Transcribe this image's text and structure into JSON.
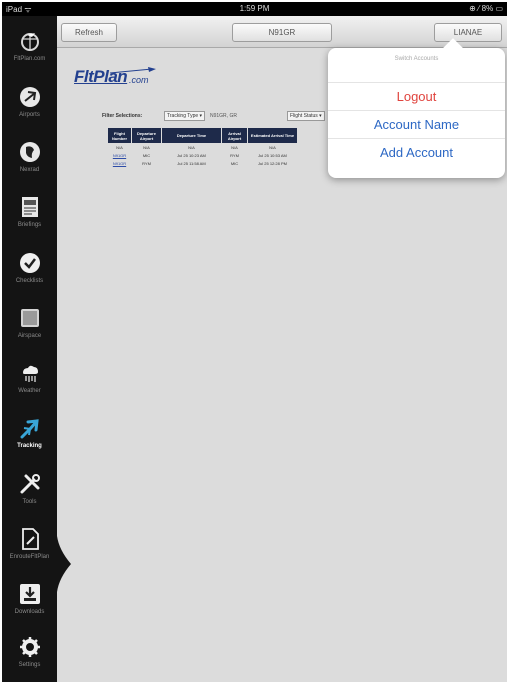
{
  "status_bar": {
    "carrier": "iPad ᯤ",
    "time": "1:59 PM",
    "battery": "⊕ ⁄ 8% ▭"
  },
  "sidebar": {
    "items": [
      {
        "label": "FltPlan.com",
        "icon": "globe-plane-icon"
      },
      {
        "label": "Airports",
        "icon": "airport-icon"
      },
      {
        "label": "Nexrad",
        "icon": "radar-icon"
      },
      {
        "label": "Briefings",
        "icon": "document-icon"
      },
      {
        "label": "Checklists",
        "icon": "checkmark-icon"
      },
      {
        "label": "Airspace",
        "icon": "airspace-icon"
      },
      {
        "label": "Weather",
        "icon": "cloud-rain-icon"
      },
      {
        "label": "Tracking",
        "icon": "plane-icon"
      },
      {
        "label": "Tools",
        "icon": "tools-icon"
      },
      {
        "label": "EnrouteFltPlan",
        "icon": "edit-document-icon"
      },
      {
        "label": "Downloads",
        "icon": "download-icon"
      },
      {
        "label": "Settings",
        "icon": "gear-icon"
      }
    ],
    "active_index": 7
  },
  "toolbar": {
    "refresh_label": "Refresh",
    "center_label": "N91GR",
    "account_label": "LIANAE"
  },
  "logo": {
    "text": "FltPlan",
    "suffix": ".com"
  },
  "filter": {
    "label": "Filter Selections:",
    "select1": "Tracking Type ▾",
    "text1": "N91GR, GR",
    "select2": "Flight Status ▾"
  },
  "table": {
    "headers": [
      "Flight Number",
      "Departure Airport",
      "Departure Time",
      "Arrival Airport",
      "Estimated Arrival Time"
    ],
    "rows": [
      {
        "flight": "N/A",
        "dep": "N/A",
        "dtime": "N/A",
        "arr": "N/A",
        "eta": "N/A",
        "link": false
      },
      {
        "flight": "N91GR",
        "dep": "MIC",
        "dtime": "Jul 25 10:23 AM",
        "arr": "RYM",
        "eta": "Jul 25 10:53 AM",
        "link": true
      },
      {
        "flight": "N91GR",
        "dep": "RYM",
        "dtime": "Jul 25 11:58 AM",
        "arr": "MIC",
        "eta": "Jul 25 12:28 PM",
        "link": true
      }
    ]
  },
  "popover": {
    "header": "Switch Accounts",
    "items": [
      {
        "label": "Logout",
        "color": "#e0443e"
      },
      {
        "label": "Account Name",
        "color": "#2d68c4"
      },
      {
        "label": "Add Account",
        "color": "#2d68c4"
      }
    ]
  }
}
